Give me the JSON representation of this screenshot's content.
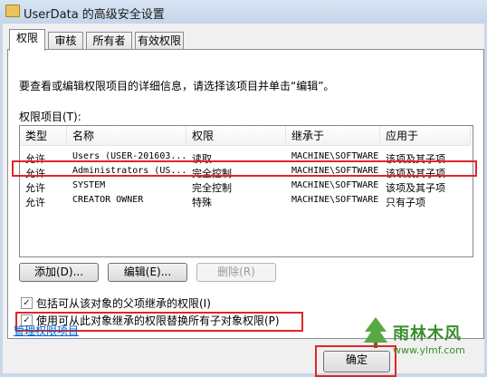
{
  "window": {
    "title": "UserData 的高级安全设置"
  },
  "tabs": [
    {
      "label": "权限"
    },
    {
      "label": "审核"
    },
    {
      "label": "所有者"
    },
    {
      "label": "有效权限"
    }
  ],
  "description": "要查看或编辑权限项目的详细信息，请选择该项目并单击“编辑”。",
  "permissions": {
    "label": "权限项目(T):",
    "columns": [
      "类型",
      "名称",
      "权限",
      "继承于",
      "应用于"
    ],
    "rows": [
      {
        "type": "允许",
        "name": "Users (USER-201603...",
        "perm": "读取",
        "inherit": "MACHINE\\SOFTWARE",
        "apply": "该项及其子项"
      },
      {
        "type": "允许",
        "name": "Administrators (US...",
        "perm": "完全控制",
        "inherit": "MACHINE\\SOFTWARE",
        "apply": "该项及其子项"
      },
      {
        "type": "允许",
        "name": "SYSTEM",
        "perm": "完全控制",
        "inherit": "MACHINE\\SOFTWARE",
        "apply": "该项及其子项"
      },
      {
        "type": "允许",
        "name": "CREATOR OWNER",
        "perm": "特殊",
        "inherit": "MACHINE\\SOFTWARE",
        "apply": "只有子项"
      }
    ]
  },
  "buttons": {
    "add": "添加(D)...",
    "edit": "编辑(E)...",
    "remove": "删除(R)"
  },
  "checkboxes": [
    {
      "label": "包括可从该对象的父项继承的权限(I)",
      "checked": true
    },
    {
      "label": "使用可从此对象继承的权限替换所有子对象权限(P)",
      "checked": true
    }
  ],
  "link": "管理权限项目",
  "ok_label": "确定",
  "watermark": {
    "name": "雨林木风",
    "url": "www.ylmf.com"
  }
}
